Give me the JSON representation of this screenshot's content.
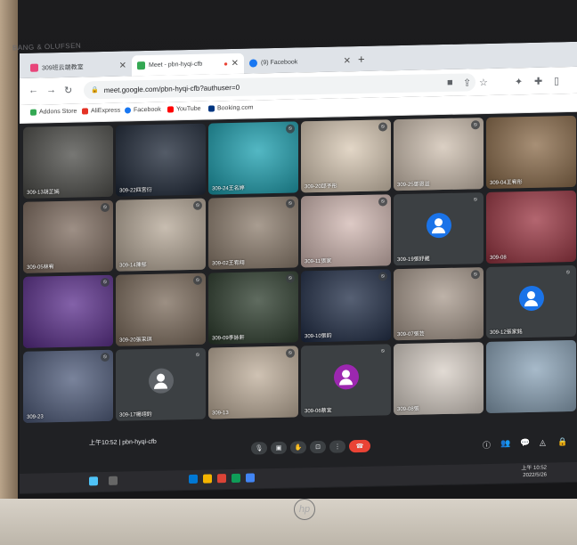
{
  "brand": "BANG & OLUFSEN",
  "tabs": [
    {
      "label": "309班云端教室",
      "fav": "#e8457a"
    },
    {
      "label": "Meet - pbn-hyqi-cfb",
      "fav": "#34a853"
    },
    {
      "label": "(9) Facebook",
      "fav": "#1877f2"
    }
  ],
  "address": {
    "url": "meet.google.com/pbn-hyqi-cfb?authuser=0"
  },
  "bookmarks": [
    {
      "label": "Addons Store",
      "color": "#34a853"
    },
    {
      "label": "AliExpress",
      "color": "#e43225"
    },
    {
      "label": "Facebook",
      "color": "#1877f2"
    },
    {
      "label": "YouTube",
      "color": "#ff0000"
    },
    {
      "label": "Booking.com",
      "color": "#003580"
    }
  ],
  "participants": [
    {
      "name": "309-13胡芷嫣",
      "kind": "video",
      "bg": "#4a4a46",
      "muted": false
    },
    {
      "name": "309-22四宮衍",
      "kind": "video",
      "bg": "#1b2535",
      "muted": false
    },
    {
      "name": "309-24王名婷",
      "kind": "video",
      "bg": "#1aa0b0",
      "muted": true
    },
    {
      "name": "309-20邱予彤",
      "kind": "video",
      "bg": "#d9c9b4",
      "muted": true
    },
    {
      "name": "309-25鄧恩溢",
      "kind": "video",
      "bg": "#cfc0b0",
      "muted": true
    },
    {
      "name": "309-04王宥彤",
      "kind": "video",
      "bg": "#8a6a48",
      "muted": false
    },
    {
      "name": "309-05林宥",
      "kind": "video",
      "bg": "#7d6a5d",
      "muted": true
    },
    {
      "name": "309-14陳郁",
      "kind": "video",
      "bg": "#b5a796",
      "muted": true
    },
    {
      "name": "309-02王宥翔",
      "kind": "video",
      "bg": "#8c7c6c",
      "muted": true
    },
    {
      "name": "309-11張家",
      "kind": "video",
      "bg": "#d2b8b2",
      "muted": true
    },
    {
      "name": "309-19張妤葳",
      "kind": "avatar",
      "bg": "#3c4043",
      "avatar_color": "#1a73e8",
      "muted": true
    },
    {
      "name": "309-08",
      "kind": "video",
      "bg": "#9a3340",
      "muted": false
    },
    {
      "name": "",
      "kind": "video",
      "bg": "#5a2d8c",
      "muted": true
    },
    {
      "name": "309-20張采琪",
      "kind": "video",
      "bg": "#7b6a5a",
      "muted": true
    },
    {
      "name": "309-09李詠軒",
      "kind": "video",
      "bg": "#2a3a2a",
      "muted": true
    },
    {
      "name": "309-10張鈞",
      "kind": "video",
      "bg": "#1e2b45",
      "muted": true
    },
    {
      "name": "309-07張芸",
      "kind": "video",
      "bg": "#a8998c",
      "muted": true
    },
    {
      "name": "309-12張家銘",
      "kind": "avatar",
      "bg": "#3c4043",
      "avatar_color": "#1a73e8",
      "muted": true
    },
    {
      "name": "309-23",
      "kind": "video",
      "bg": "#4d5a7a",
      "muted": true
    },
    {
      "name": "309-17楊翊鈞",
      "kind": "avatar",
      "bg": "#3c4043",
      "avatar_color": "#5f6368",
      "muted": true
    },
    {
      "name": "309-13",
      "kind": "video",
      "bg": "#bfae9a",
      "muted": true
    },
    {
      "name": "309-06蔡宜",
      "kind": "avatar",
      "bg": "#3c4043",
      "avatar_color": "#9c27b0",
      "muted": true
    },
    {
      "name": "309-08張",
      "kind": "video",
      "bg": "#d8cfc6",
      "muted": false
    },
    {
      "name": "",
      "kind": "video",
      "bg": "#8aa3b8",
      "muted": false
    }
  ],
  "meeting_code": "上午10:52 | pbn-hyqi-cfb",
  "clock": {
    "time": "上午 10:52",
    "date": "2022/5/26"
  },
  "hp_logo": "hp"
}
